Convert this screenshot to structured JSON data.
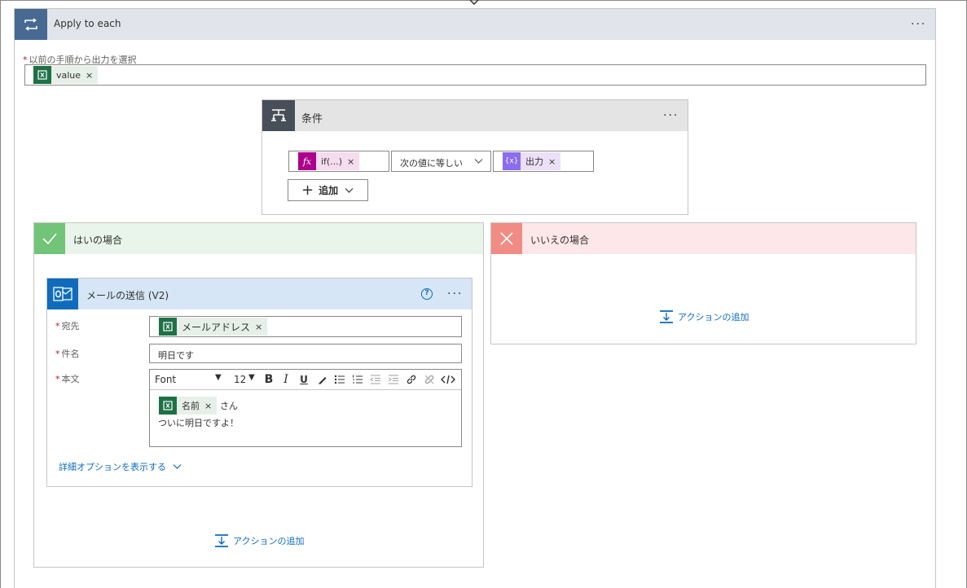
{
  "loop": {
    "title": "Apply to each",
    "field_label": "以前の手順から出力を選択",
    "token": "value"
  },
  "condition": {
    "title": "条件",
    "left_token": "if(...)",
    "operator": "次の値に等しい",
    "right_token": "出力",
    "add_label": "追加"
  },
  "yes_branch": {
    "title": "はいの場合",
    "add_action": "アクションの追加"
  },
  "no_branch": {
    "title": "いいえの場合",
    "add_action": "アクションの追加"
  },
  "send_mail": {
    "title": "メールの送信 (V2)",
    "to_label": "宛先",
    "to_token": "メールアドレス",
    "subject_label": "件名",
    "subject_value": "明日です",
    "body_label": "本文",
    "toolbar": {
      "font": "Font",
      "size": "12"
    },
    "body_token": "名前",
    "body_suffix": "さん",
    "body_line2": "ついに明日ですよ！",
    "advanced_options": "詳細オプションを表示する"
  },
  "colors": {
    "loop_accent": "#486991",
    "condition_accent": "#484f58",
    "yes_accent": "#71c478",
    "no_accent": "#f08c84",
    "mail_accent": "#0f6cbd",
    "excel_green": "#1e7145",
    "expression_purple": "#ad008c",
    "variable_purple": "#770bd6"
  }
}
